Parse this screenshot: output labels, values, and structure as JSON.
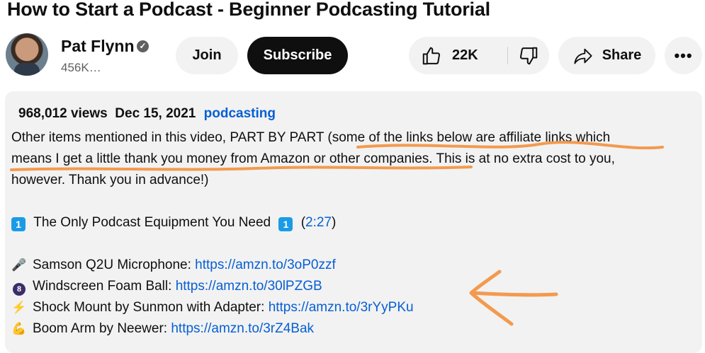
{
  "video": {
    "title": "How to Start a Podcast - Beginner Podcasting Tutorial"
  },
  "channel": {
    "name": "Pat Flynn",
    "verified_glyph": "✓",
    "subscribers": "456K…"
  },
  "actions": {
    "join_label": "Join",
    "subscribe_label": "Subscribe",
    "like_count": "22K",
    "share_label": "Share",
    "more_glyph": "•••"
  },
  "description": {
    "views": "968,012 views",
    "date": "Dec 15, 2021",
    "tag": "podcasting",
    "intro_line1": "Other items mentioned in this video, PART BY PART (some of the links below are affiliate links which",
    "intro_line2": "means I get a little thank you money from Amazon or other companies. This is at no extra cost to you,",
    "intro_line3": "however. Thank you in advance!)",
    "section": {
      "badge": "1",
      "title": "The Only Podcast Equipment You Need",
      "timestamp_open": "(",
      "timestamp": "2:27",
      "timestamp_close": ")"
    },
    "items": [
      {
        "icon": "microphone-icon",
        "glyph": "🎤",
        "label": "Samson Q2U Microphone: ",
        "url": "https://amzn.to/3oP0zzf"
      },
      {
        "icon": "eight-ball-icon",
        "glyph": "8",
        "label": "Windscreen Foam Ball: ",
        "url": "https://amzn.to/30lPZGB"
      },
      {
        "icon": "lightning-icon",
        "glyph": "⚡",
        "label": "Shock Mount by Sunmon with Adapter: ",
        "url": "https://amzn.to/3rYyPKu"
      },
      {
        "icon": "flexed-biceps-icon",
        "glyph": "💪",
        "label": "Boom Arm by Neewer: ",
        "url": "https://amzn.to/3rZ4Bak"
      }
    ]
  },
  "colors": {
    "link": "#065fd4",
    "annotation": "#f39a4f",
    "subscribe_bg": "#0f0f0f",
    "pill_bg": "#f2f2f2"
  }
}
